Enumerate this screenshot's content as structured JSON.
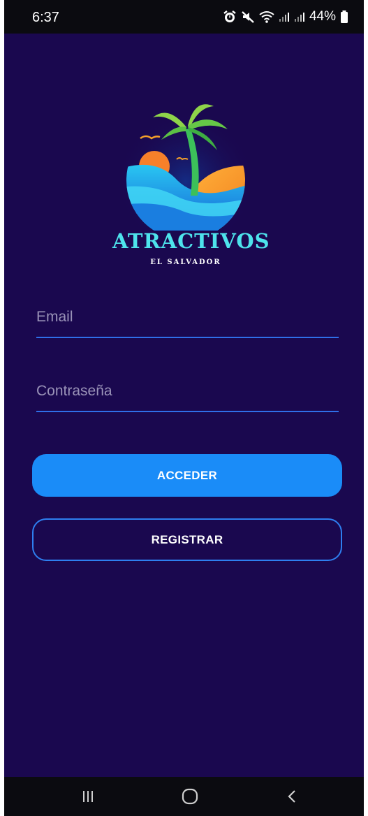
{
  "status_bar": {
    "time": "6:37",
    "battery": "44%",
    "icons": [
      "alarm-icon",
      "mute-icon",
      "wifi-icon",
      "signal-icon",
      "signal-icon",
      "battery-icon"
    ]
  },
  "logo": {
    "title": "ATRACTIVOS",
    "subtitle": "EL SALVADOR"
  },
  "form": {
    "email_placeholder": "Email",
    "password_placeholder": "Contraseña"
  },
  "buttons": {
    "login": "ACCEDER",
    "register": "REGISTRAR"
  },
  "nav_bar": {
    "icons": [
      "recent-apps-icon",
      "home-icon",
      "back-icon"
    ]
  },
  "colors": {
    "background": "#1a084f",
    "primary": "#1a8cf8",
    "outline": "#2e7ff0",
    "logo_title": "#4ee3ec"
  }
}
